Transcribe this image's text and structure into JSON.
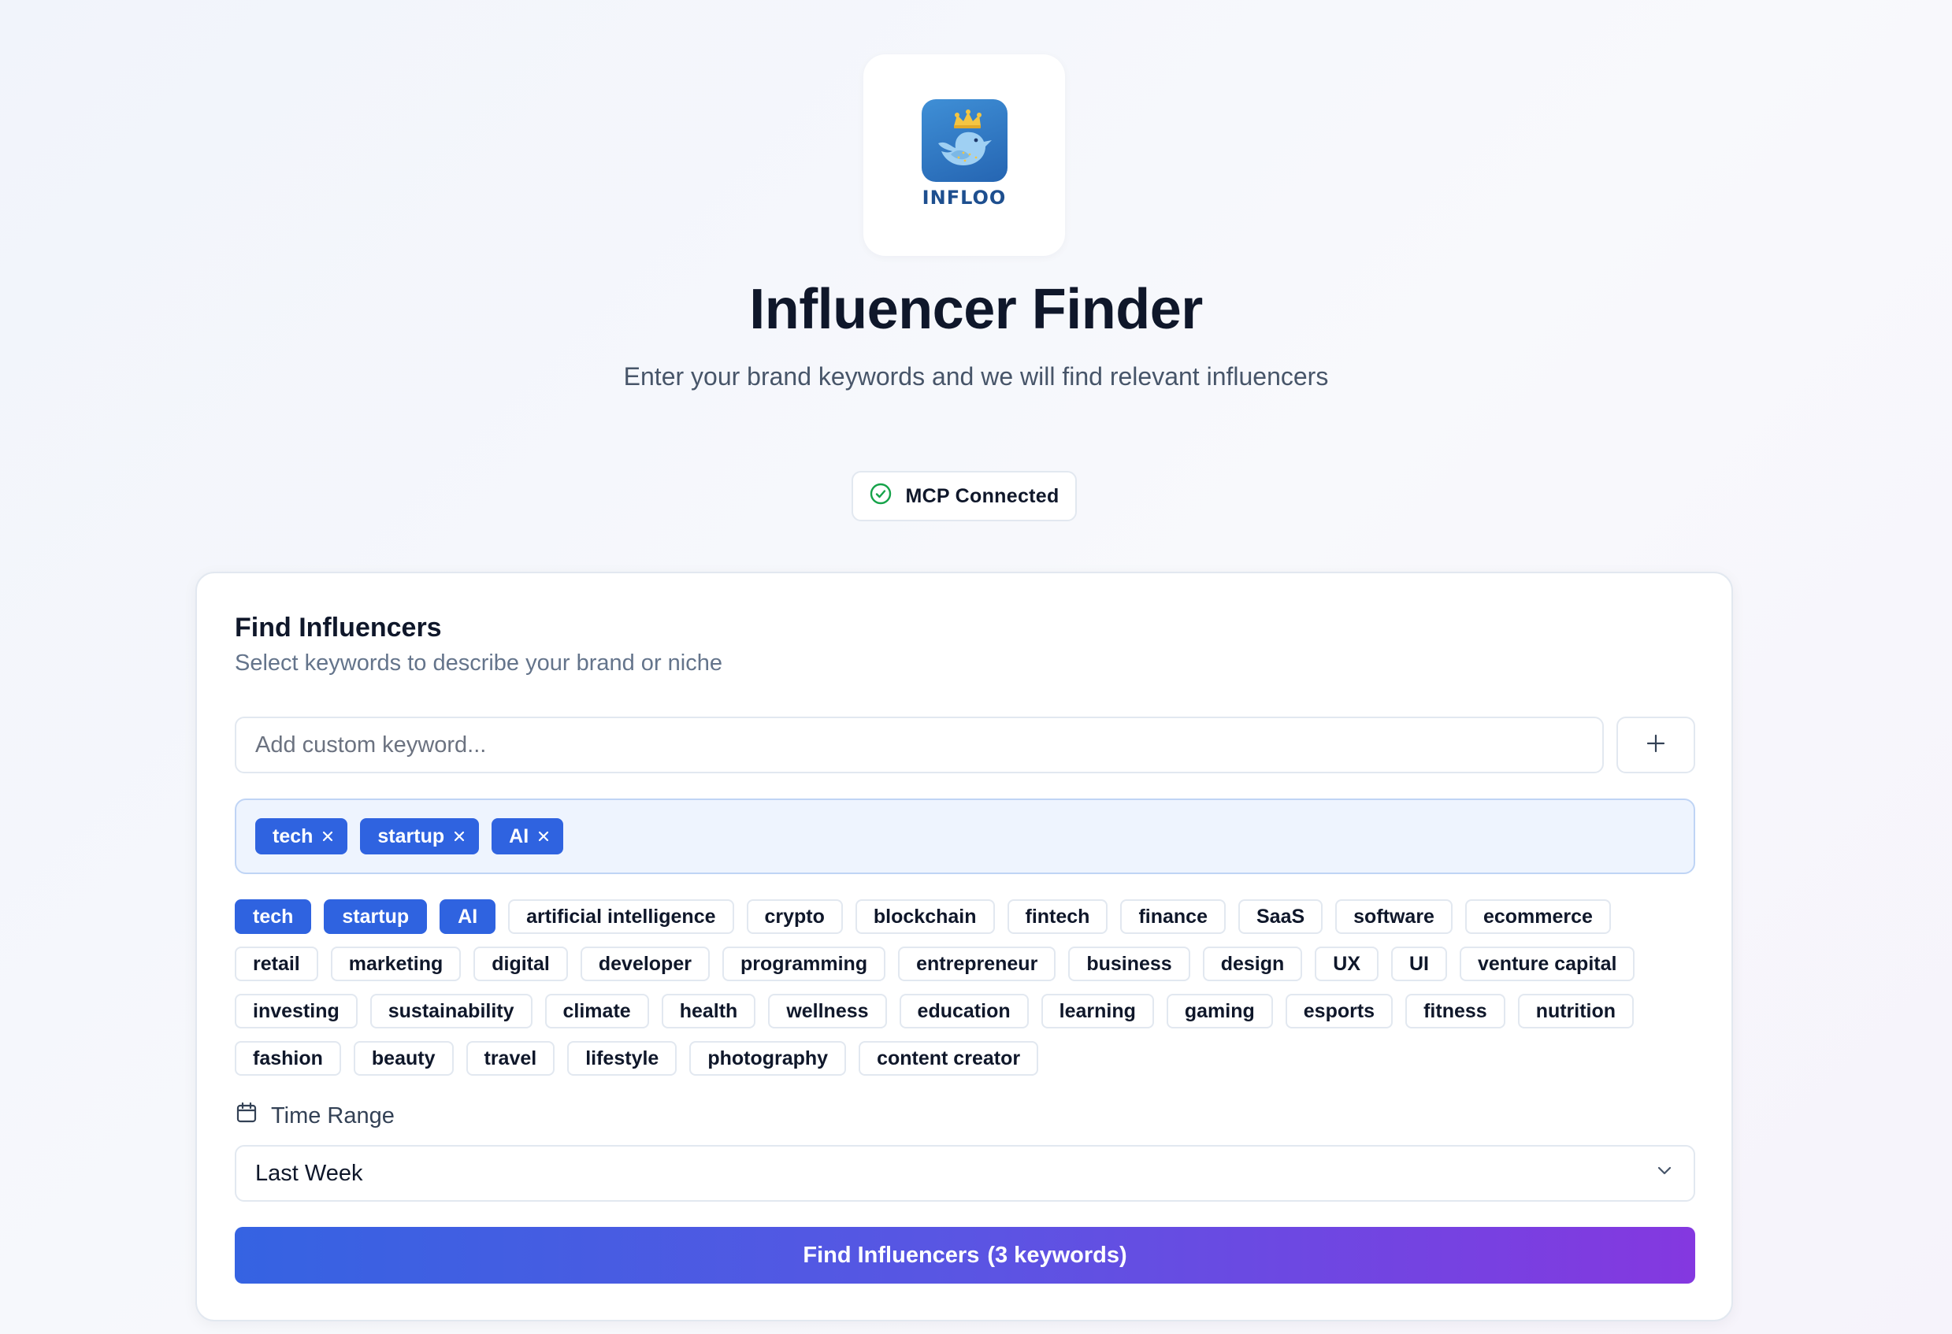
{
  "header": {
    "logo_text": "INFLOO",
    "title": "Influencer Finder",
    "subtitle": "Enter your brand keywords and we will find relevant influencers"
  },
  "status": {
    "label": "MCP Connected",
    "icon": "check-circle-icon",
    "color": "#16a34a"
  },
  "form": {
    "title": "Find Influencers",
    "subtitle": "Select keywords to describe your brand or niche",
    "input_placeholder": "Add custom keyword...",
    "input_value": "",
    "add_icon": "plus-icon",
    "selected_keywords": [
      "tech",
      "startup",
      "AI"
    ],
    "keywords": [
      "tech",
      "startup",
      "AI",
      "artificial intelligence",
      "crypto",
      "blockchain",
      "fintech",
      "finance",
      "SaaS",
      "software",
      "ecommerce",
      "retail",
      "marketing",
      "digital",
      "developer",
      "programming",
      "entrepreneur",
      "business",
      "design",
      "UX",
      "UI",
      "venture capital",
      "investing",
      "sustainability",
      "climate",
      "health",
      "wellness",
      "education",
      "learning",
      "gaming",
      "esports",
      "fitness",
      "nutrition",
      "fashion",
      "beauty",
      "travel",
      "lifestyle",
      "photography",
      "content creator"
    ],
    "time_range_label": "Time Range",
    "time_range_value": "Last Week",
    "submit_prefix": "Find Influencers",
    "submit_count": "(3 keywords)"
  },
  "colors": {
    "accent": "#2f63e0",
    "button_gradient_start": "#3563e2",
    "button_gradient_end": "#8438e0",
    "selected_bg": "#eef4fe"
  }
}
